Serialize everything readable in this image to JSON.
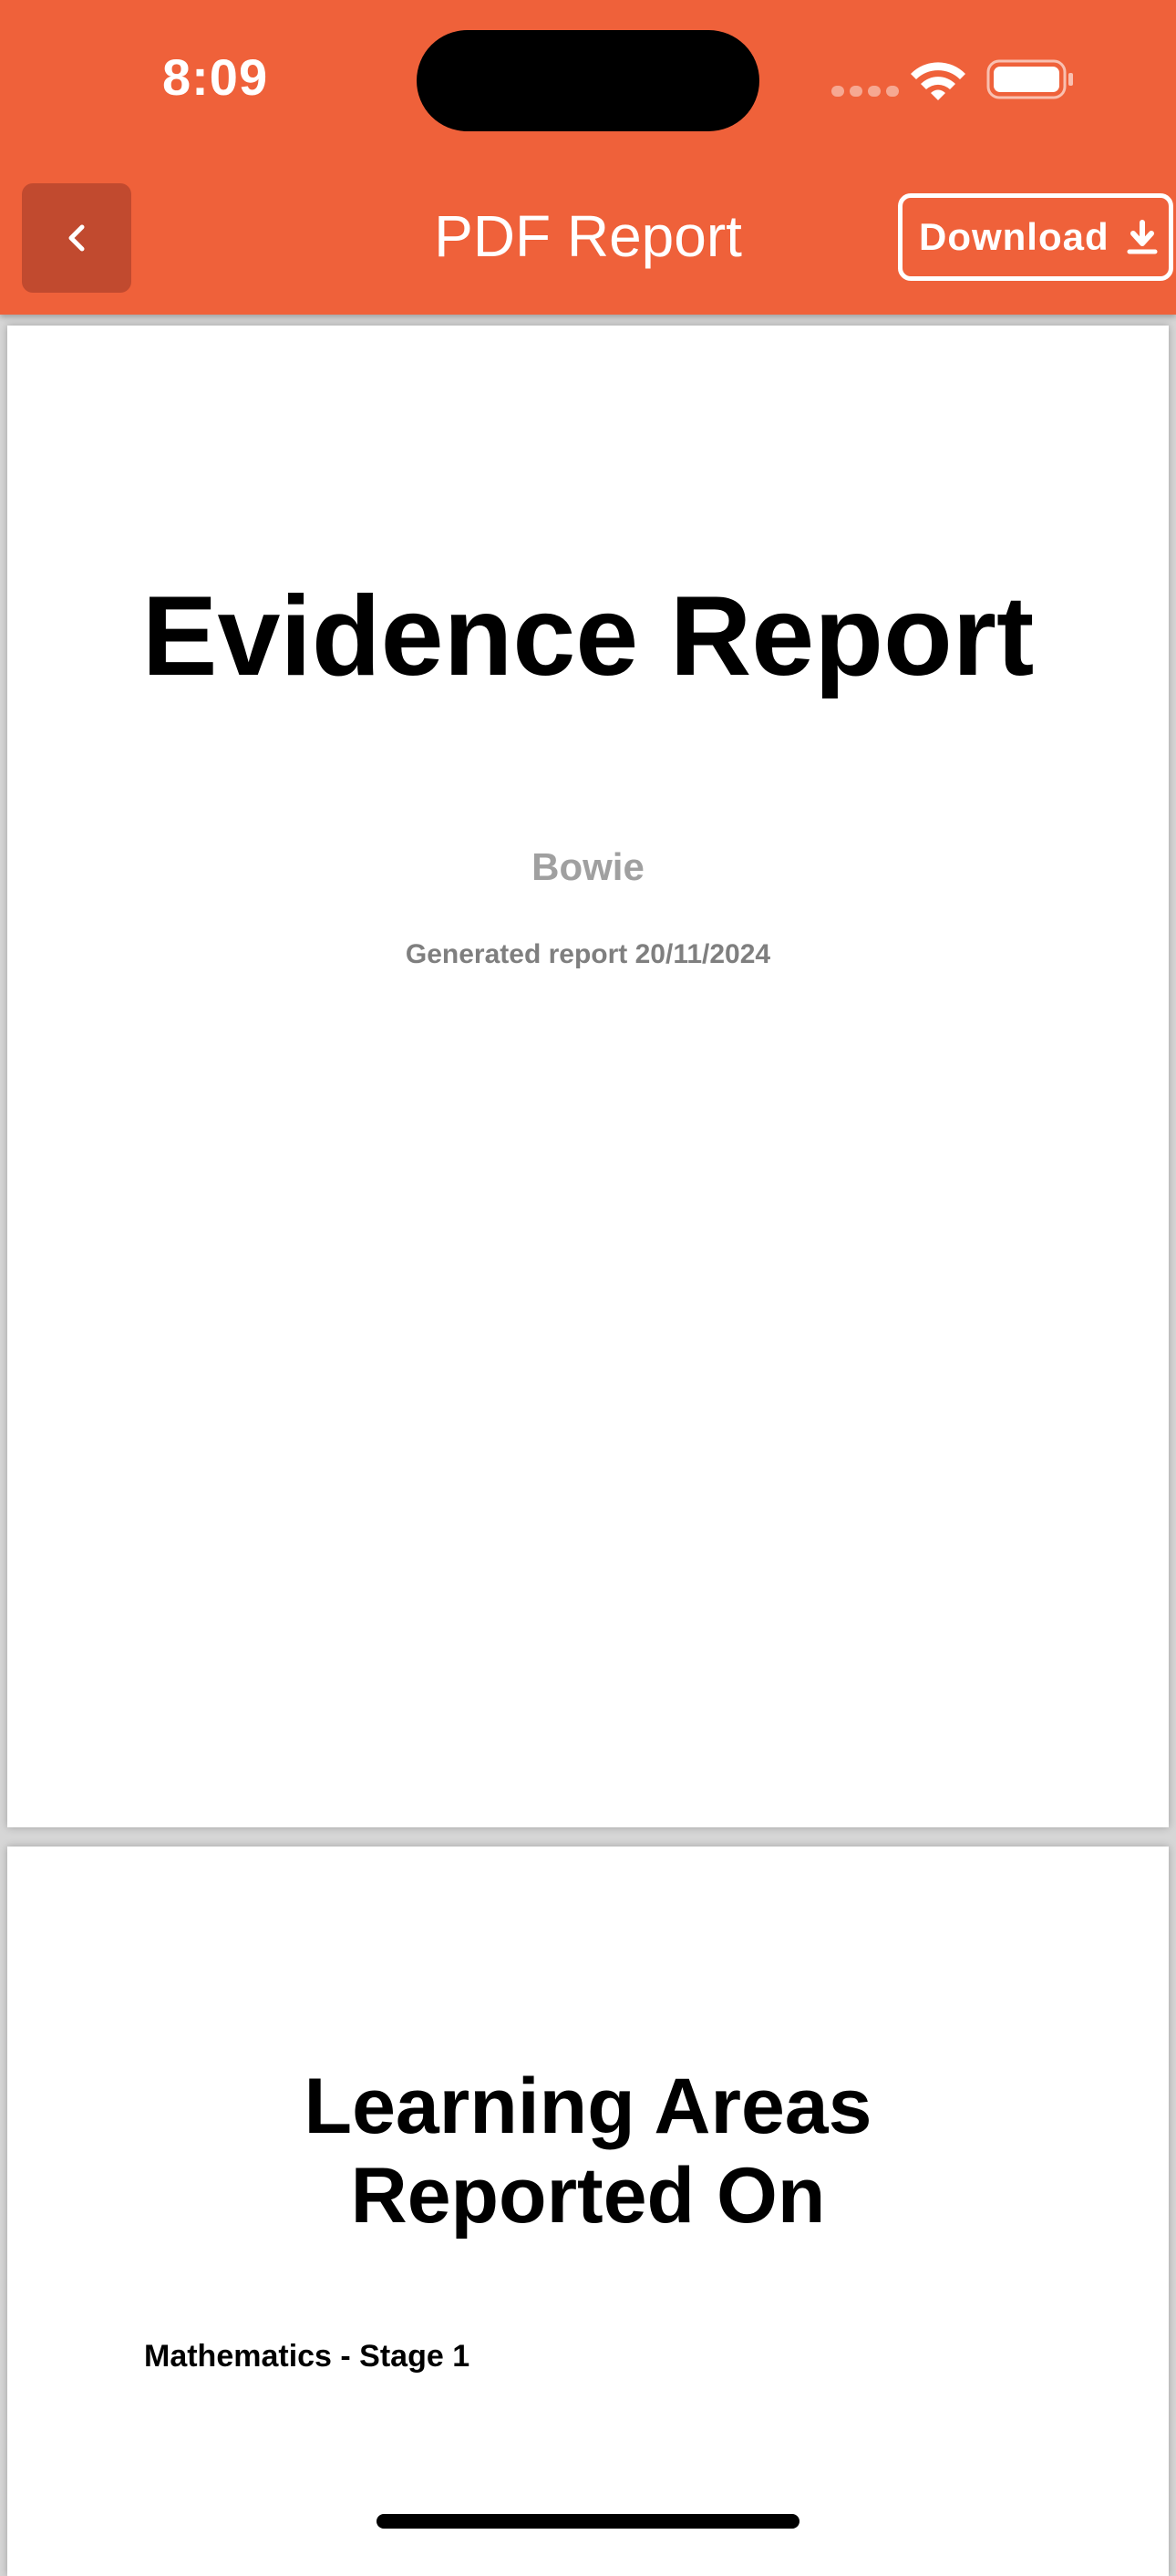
{
  "status_bar": {
    "time": "8:09"
  },
  "header": {
    "title": "PDF Report",
    "download_label": "Download",
    "accent_color": "#EF613A",
    "back_button_color": "#C14A2F"
  },
  "icons": {
    "back": "chevron-left-icon",
    "download": "download-arrow-icon",
    "wifi": "wifi-icon",
    "battery": "battery-icon"
  },
  "pdf": {
    "page1": {
      "title": "Evidence Report",
      "subject": "Bowie",
      "generated": "Generated report 20/11/2024"
    },
    "page2": {
      "title_line1": "Learning Areas",
      "title_line2": "Reported On",
      "items": [
        "Mathematics - Stage 1"
      ]
    }
  }
}
